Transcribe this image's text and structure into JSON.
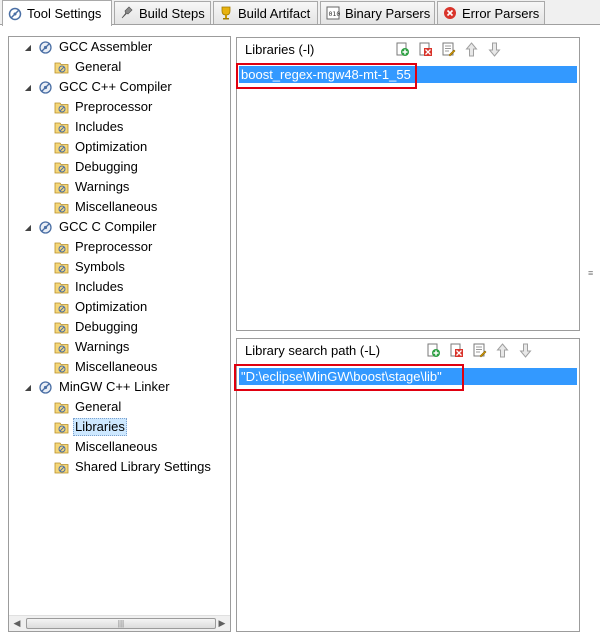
{
  "tabs": [
    {
      "label": "Tool Settings",
      "icon": "tool-settings-icon",
      "active": true
    },
    {
      "label": "Build Steps",
      "icon": "build-steps-icon"
    },
    {
      "label": "Build Artifact",
      "icon": "build-artifact-icon"
    },
    {
      "label": "Binary Parsers",
      "icon": "binary-parsers-icon"
    },
    {
      "label": "Error Parsers",
      "icon": "error-parsers-icon"
    }
  ],
  "tree": {
    "items": [
      {
        "label": "GCC Assembler",
        "level": 0,
        "expanded": true
      },
      {
        "label": "General",
        "level": 1
      },
      {
        "label": "GCC C++ Compiler",
        "level": 0,
        "expanded": true
      },
      {
        "label": "Preprocessor",
        "level": 1
      },
      {
        "label": "Includes",
        "level": 1
      },
      {
        "label": "Optimization",
        "level": 1
      },
      {
        "label": "Debugging",
        "level": 1
      },
      {
        "label": "Warnings",
        "level": 1
      },
      {
        "label": "Miscellaneous",
        "level": 1
      },
      {
        "label": "GCC C Compiler",
        "level": 0,
        "expanded": true
      },
      {
        "label": "Preprocessor",
        "level": 1
      },
      {
        "label": "Symbols",
        "level": 1
      },
      {
        "label": "Includes",
        "level": 1
      },
      {
        "label": "Optimization",
        "level": 1
      },
      {
        "label": "Debugging",
        "level": 1
      },
      {
        "label": "Warnings",
        "level": 1
      },
      {
        "label": "Miscellaneous",
        "level": 1
      },
      {
        "label": "MinGW C++ Linker",
        "level": 0,
        "expanded": true
      },
      {
        "label": "General",
        "level": 1
      },
      {
        "label": "Libraries",
        "level": 1,
        "selected": true
      },
      {
        "label": "Miscellaneous",
        "level": 1
      },
      {
        "label": "Shared Library Settings",
        "level": 1
      }
    ]
  },
  "libraries": {
    "title": "Libraries (-l)",
    "items": [
      "boost_regex-mgw48-mt-1_55"
    ]
  },
  "library_search_path": {
    "title": "Library search path (-L)",
    "items": [
      "\"D:\\eclipse\\MinGW\\boost\\stage\\lib\""
    ]
  },
  "toolbar_icons": [
    "add-icon",
    "delete-icon",
    "edit-icon",
    "move-up-icon",
    "move-down-icon"
  ],
  "colors": {
    "selection": "#3399ff",
    "highlight_box": "#e0000f",
    "tree_selection": "#cde8ff"
  }
}
